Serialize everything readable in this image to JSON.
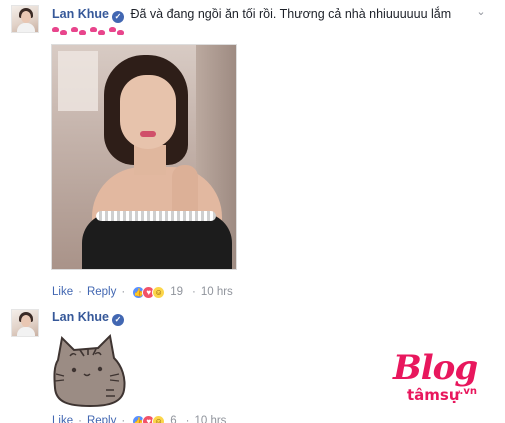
{
  "comments": [
    {
      "author": "Lan Khue",
      "text": "Đã và đang ngồi ăn tối rồi. Thương cả nhà nhiuuuuuu lắm",
      "emoji": "kiss-mark x4",
      "actions": {
        "like": "Like",
        "reply": "Reply",
        "reaction_count": "19",
        "time": "10 hrs"
      }
    },
    {
      "author": "Lan Khue",
      "sticker": "pusheen-cat-sticker",
      "actions": {
        "like": "Like",
        "reply": "Reply",
        "reaction_count": "6",
        "time": "10 hrs"
      }
    }
  ],
  "watermark": {
    "main": "Blog",
    "sub": "tâmsự",
    "domain": ".vn"
  },
  "colors": {
    "author": "#365899",
    "link": "#4267b2",
    "meta": "#90949c",
    "watermark": "#e8175d"
  },
  "icons": [
    "verified-badge-icon",
    "chevron-down-icon",
    "like-reaction-icon",
    "love-reaction-icon",
    "haha-reaction-icon"
  ]
}
